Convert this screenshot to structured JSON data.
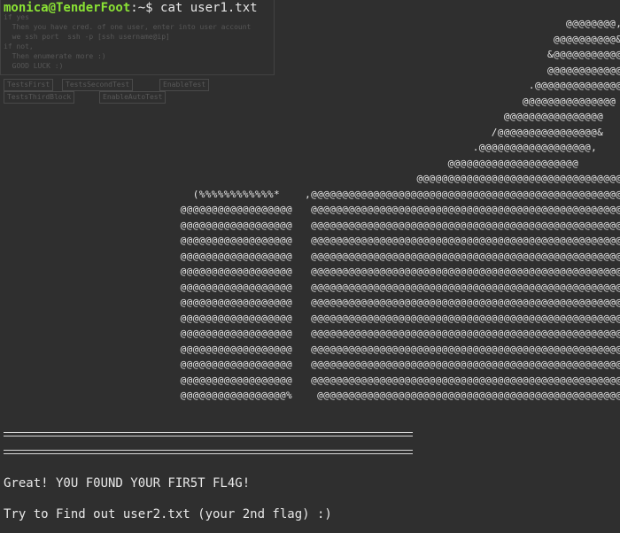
{
  "prompt": {
    "user_host": "monica@TenderFoot",
    "separator": ":~$",
    "command": " cat user1.txt"
  },
  "ghost_window": {
    "code": "if yes\n  Then you have cred. of one user, enter into user account\n  we ssh port  ssh -p [ssh username@ip]\nif not,\n  Then enumerate more :)\n  GOOD LUCK :)",
    "buttons": [
      "TestsFirst",
      "TestsSecondTest",
      "EnableTest",
      "TestsThirdBlock",
      "EnableAutoTest"
    ]
  },
  "ascii_art": "                                                                                           @@@@@@@@,\n                                                                                         @@@@@@@@@@&\n                                                                                        &@@@@@@@@@@@*\n                                                                                        @@@@@@@@@@@@@,\n                                                                                     .@@@@@@@@@@@@@@\n                                                                                    @@@@@@@@@@@@@@@\n                                                                                 @@@@@@@@@@@@@@@@\n                                                                               /@@@@@@@@@@@@@@@@&\n                                                                            .@@@@@@@@@@@@@@@@@@,\n                                                                        @@@@@@@@@@@@@@@@@@@@@\n                                                                   @@@@@@@@@@@@@@@@@@@@@@@@@@@@@@@@@@@@@@@@@@@@@@@@@@@@*\n                               (%%%%%%%%%%%%*    ,@@@@@@@@@@@@@@@@@@@@@@@@@@@@@@@@@@@@@@@@@@@@@@@@@@@@@@@@@@@@@@.\n                             @@@@@@@@@@@@@@@@@@   @@@@@@@@@@@@@@@@@@@@@@@@@@@@@@@@@@@@@@@@@@@@@@@@@@@@@@@@@@@@@@@\n                             @@@@@@@@@@@@@@@@@@   @@@@@@@@@@@@@@@@@@@@@@@@@@@@@@@@@@@@@@@@@@@@@@@@@@@@@@@@@@@@@@%\n                             @@@@@@@@@@@@@@@@@@   @@@@@@@@@@@@@@@@@@@@@@@@@@@@@@@@@@@@@@@@@@@@@@@@@@@@@@@@@@@@.\n                             @@@@@@@@@@@@@@@@@@   @@@@@@@@@@@@@@@@@@@@@@@@@@@@@@@@@@@@@@@@@@@@@@@@@@@@@@@@@@@@@&\n                             @@@@@@@@@@@@@@@@@@   @@@@@@@@@@@@@@@@@@@@@@@@@@@@@@@@@@@@@@@@@@@@@@@@@@@@@@@@@@@@@@/\n                             @@@@@@@@@@@@@@@@@@   @@@@@@@@@@@@@@@@@@@@@@@@@@@@@@@@@@@@@@@@@@@@@@@@@@@@@@@@@@@@@@\n                             @@@@@@@@@@@@@@@@@@   @@@@@@@@@@@@@@@@@@@@@@@@@@@@@@@@@@@@@@@@@@@@@@@@@@@@@@@@@@@&.\n                             @@@@@@@@@@@@@@@@@@   @@@@@@@@@@@@@@@@@@@@@@@@@@@@@@@@@@@@@@@@@@@@@@@@@@@@@@@@@@@@/\n                             @@@@@@@@@@@@@@@@@@   @@@@@@@@@@@@@@@@@@@@@@@@@@@@@@@@@@@@@@@@@@@@@@@@@@@@@@@@@@@(\n                             @@@@@@@@@@@@@@@@@@   @@@@@@@@@@@@@@@@@@@@@@@@@@@@@@@@@@@@@@@@@@@@@@@@@@@@@@@@@@@,\n                             @@@@@@@@@@@@@@@@@@   @@@@@@@@@@@@@@@@@@@@@@@@@@@@@@@@@@@@@@@@@@@@@@@@@@@@@@@@@*\n                             @@@@@@@@@@@@@@@@@@   @@@@@@@@@@@@@@@@@@@@@@@@@@@@@@@@@@@@@@@@@@@@@@@@@@@@@@@@@/\n                             @@@@@@@@@@@@@@@@@%    @@@@@@@@@@@@@@@@@@@@@@@@@@@@@@@@@@@@@@@@@@@@@@@@@@@@@@@.",
  "messages": {
    "flag_found": "Great! Y0U F0UND Y0UR FIR5T FL4G!",
    "next_hint": "Try to Find out user2.txt (your 2nd flag) :)"
  }
}
